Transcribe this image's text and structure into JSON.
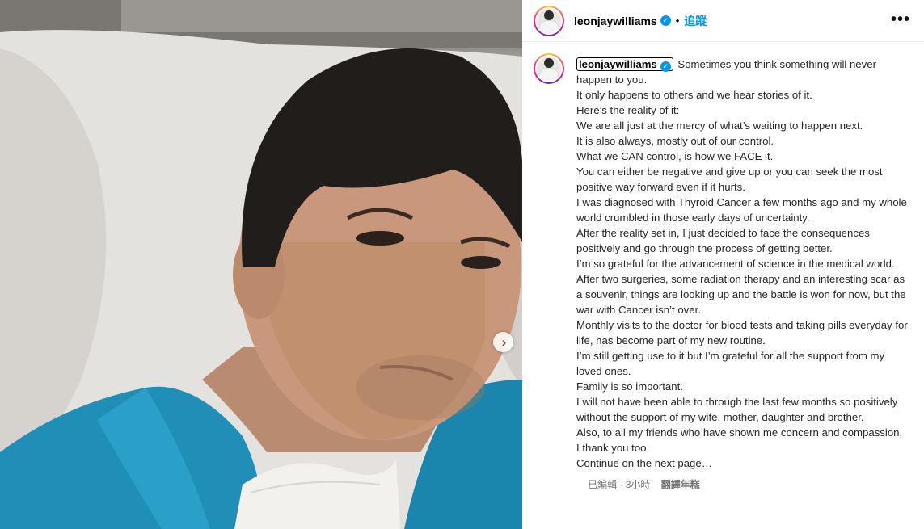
{
  "header": {
    "username": "leonjaywilliams",
    "follow_label": "追蹤",
    "more_icon": "•••"
  },
  "post": {
    "username": "leonjaywilliams",
    "first_line": "Sometimes you think something will never happen to you.",
    "lines": [
      "It only happens to others and we hear stories of it.",
      "Here’s the reality of it:",
      "We are all just at the mercy of what’s waiting to happen next.",
      "It is also always, mostly out of our control.",
      "What we CAN control, is how we FACE it.",
      "You can either be negative and give up or you can seek the most positive way forward even if it hurts.",
      "I was diagnosed with Thyroid Cancer a few months ago and my whole world crumbled in those early days of uncertainty.",
      "After the reality set in, I just decided to face the consequences positively and go through the process of getting better.",
      "I’m so grateful for the advancement of science in the medical world.",
      "After two surgeries, some radiation therapy and an interesting scar as a souvenir, things are looking up and the battle is won for now, but the war with Cancer isn’t over.",
      "Monthly visits to the doctor for blood tests and taking pills everyday for life, has become part of my new routine.",
      "I’m still getting use to it but I’m grateful for all the support from my loved ones.",
      "Family is so important.",
      "I will not have been able to through the last few months so positively without the support of my wife, mother, daughter and brother.",
      "Also, to all my friends who have shown me concern and compassion, I thank you too.",
      "Continue on the next page…"
    ],
    "edited": "已編輯",
    "time": "3小時",
    "translate_label": "翻譯年糕"
  },
  "media": {
    "next_icon": "›"
  },
  "colors": {
    "accent": "#0095f6",
    "shirt": "#1f8fb8",
    "text_secondary": "#737373"
  }
}
